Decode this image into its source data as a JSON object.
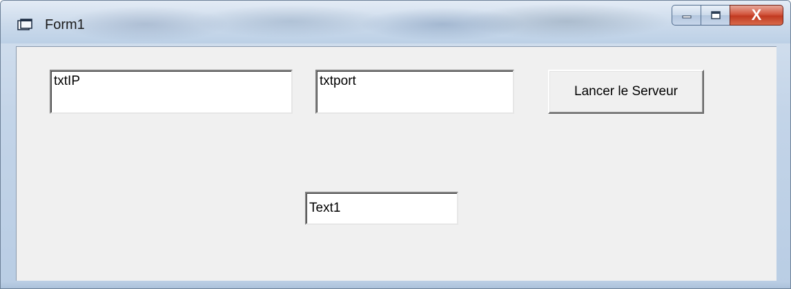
{
  "window": {
    "title": "Form1",
    "icon": "form-icon"
  },
  "caption_buttons": {
    "minimize_icon": "minimize-icon",
    "maximize_icon": "maximize-icon",
    "close_icon": "close-icon",
    "close_glyph": "X"
  },
  "form": {
    "txtIP": {
      "value": "txtIP"
    },
    "txtport": {
      "value": "txtport"
    },
    "text1": {
      "value": "Text1"
    },
    "launch_button": {
      "label": "Lancer le Serveur"
    }
  },
  "colors": {
    "client_background": "#f0f0f0",
    "close_button": "#c13a21",
    "titlebar": "#cbdaeb"
  }
}
